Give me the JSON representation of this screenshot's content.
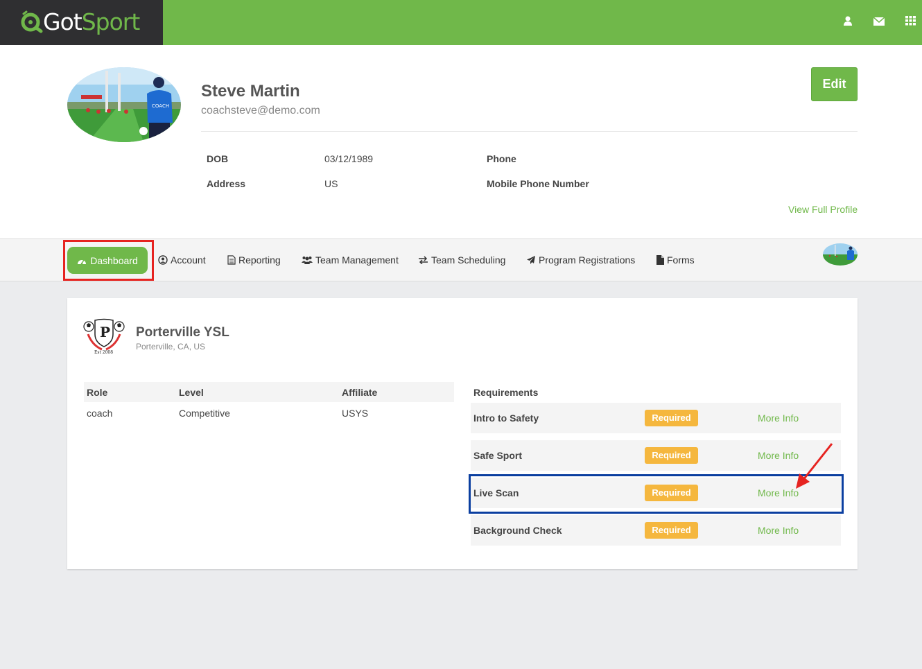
{
  "header": {
    "logo_part1": "Got",
    "logo_part2": "Sport",
    "icons": [
      "user-icon",
      "envelope-icon",
      "grid-apps-icon"
    ],
    "brand_color": "#70b84a"
  },
  "profile": {
    "name": "Steve Martin",
    "email": "coachsteve@demo.com",
    "edit_label": "Edit",
    "dob_label": "DOB",
    "dob_value": "03/12/1989",
    "address_label": "Address",
    "address_value": "US",
    "phone_label": "Phone",
    "mobile_label": "Mobile Phone Number",
    "view_full_profile": "View Full Profile"
  },
  "nav": {
    "items": [
      {
        "label": "Dashboard",
        "icon": "dashboard-icon",
        "active": true
      },
      {
        "label": "Account",
        "icon": "user-circle-icon"
      },
      {
        "label": "Reporting",
        "icon": "document-icon"
      },
      {
        "label": "Team Management",
        "icon": "users-icon"
      },
      {
        "label": "Team Scheduling",
        "icon": "exchange-icon"
      },
      {
        "label": "Program Registrations",
        "icon": "paper-plane-icon"
      },
      {
        "label": "Forms",
        "icon": "file-icon"
      }
    ]
  },
  "club": {
    "name": "Porterville YSL",
    "location": "Porterville, CA, US",
    "table": {
      "headers": [
        "Role",
        "Level",
        "Affiliate"
      ],
      "row": [
        "coach",
        "Competitive",
        "USYS"
      ]
    },
    "requirements_title": "Requirements",
    "requirements": [
      {
        "name": "Intro to Safety",
        "status": "Required",
        "link": "More Info"
      },
      {
        "name": "Safe Sport",
        "status": "Required",
        "link": "More Info"
      },
      {
        "name": "Live Scan",
        "status": "Required",
        "link": "More Info"
      },
      {
        "name": "Background Check",
        "status": "Required",
        "link": "More Info"
      }
    ]
  }
}
